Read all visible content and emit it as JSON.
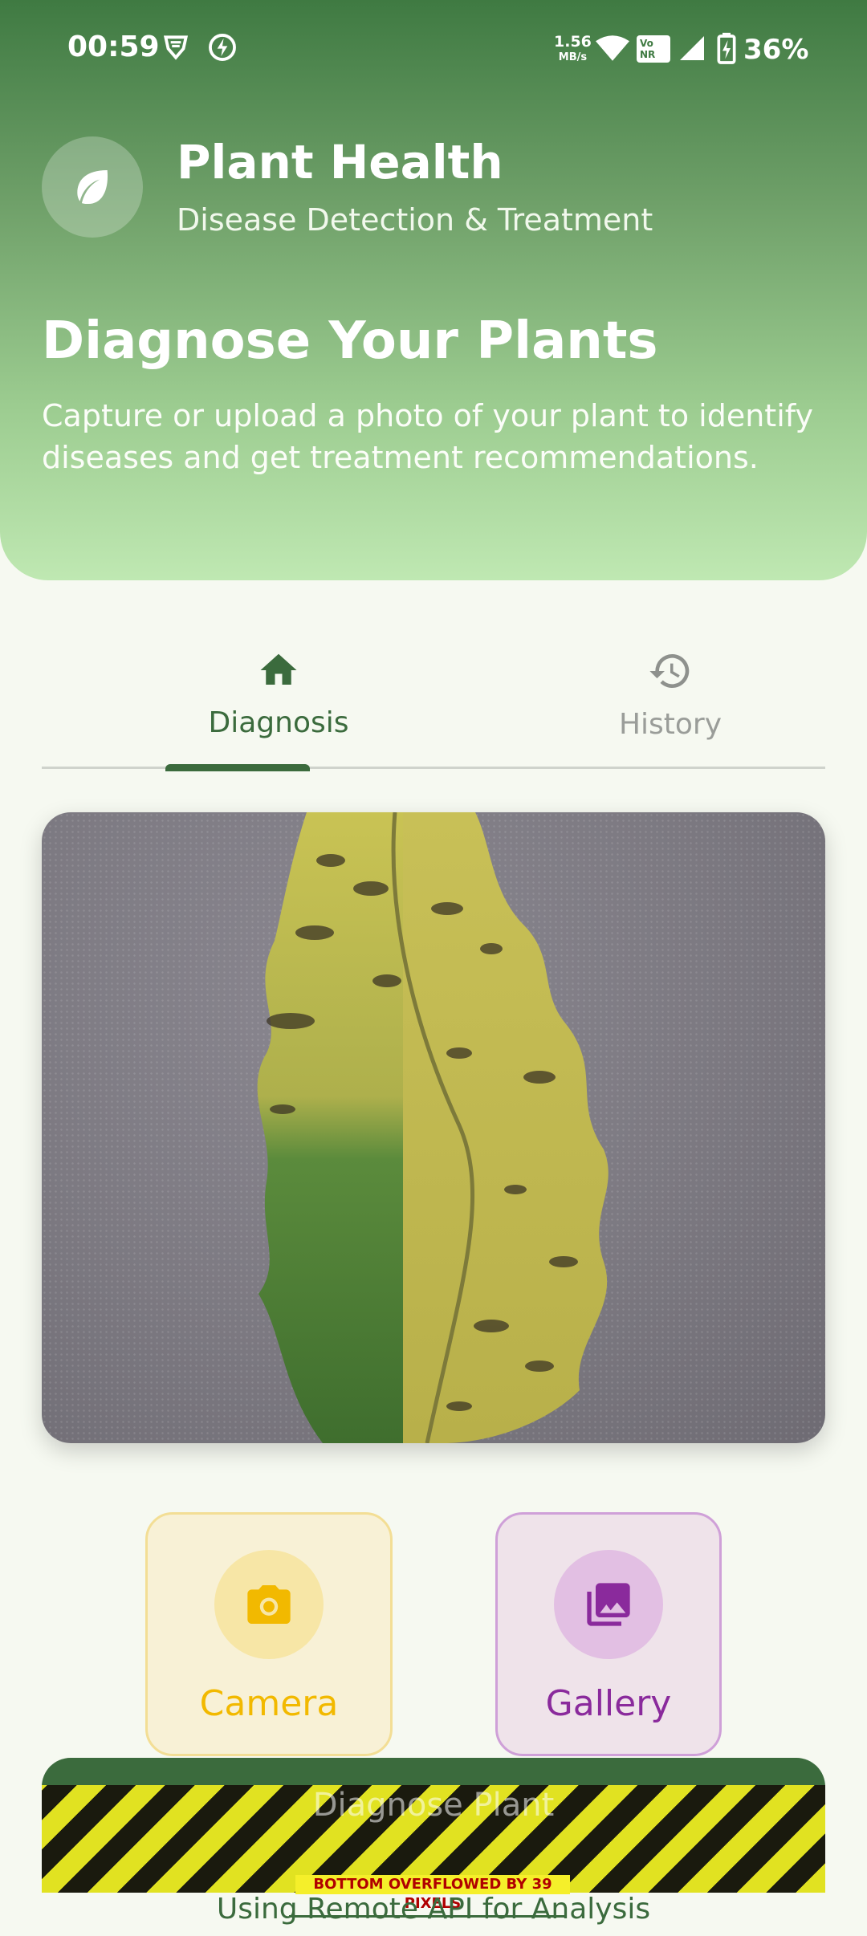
{
  "status_bar": {
    "time": "00:59",
    "net_speed": "1.56",
    "net_speed_unit": "MB/s",
    "volte_label_1": "Vo",
    "volte_label_2": "NR",
    "battery": "36%"
  },
  "header": {
    "title": "Plant Health",
    "subtitle": "Disease Detection & Treatment",
    "hero_title": "Diagnose Your Plants",
    "hero_description": "Capture or upload a photo of your plant to identify diseases and get treatment recommendations."
  },
  "tabs": [
    {
      "label": "Diagnosis",
      "icon": "home-icon",
      "selected": true
    },
    {
      "label": "History",
      "icon": "history-icon",
      "selected": false
    }
  ],
  "actions": {
    "camera_label": "Camera",
    "gallery_label": "Gallery"
  },
  "diagnose_button": {
    "label": "Diagnose Plant"
  },
  "overflow_warning": "BOTTOM OVERFLOWED BY 39 PIXELS",
  "api_note": "Using Remote API for Analysis",
  "colors": {
    "primary": "#3b6b3d",
    "camera_accent": "#f2b900",
    "gallery_accent": "#8a2a9c"
  }
}
